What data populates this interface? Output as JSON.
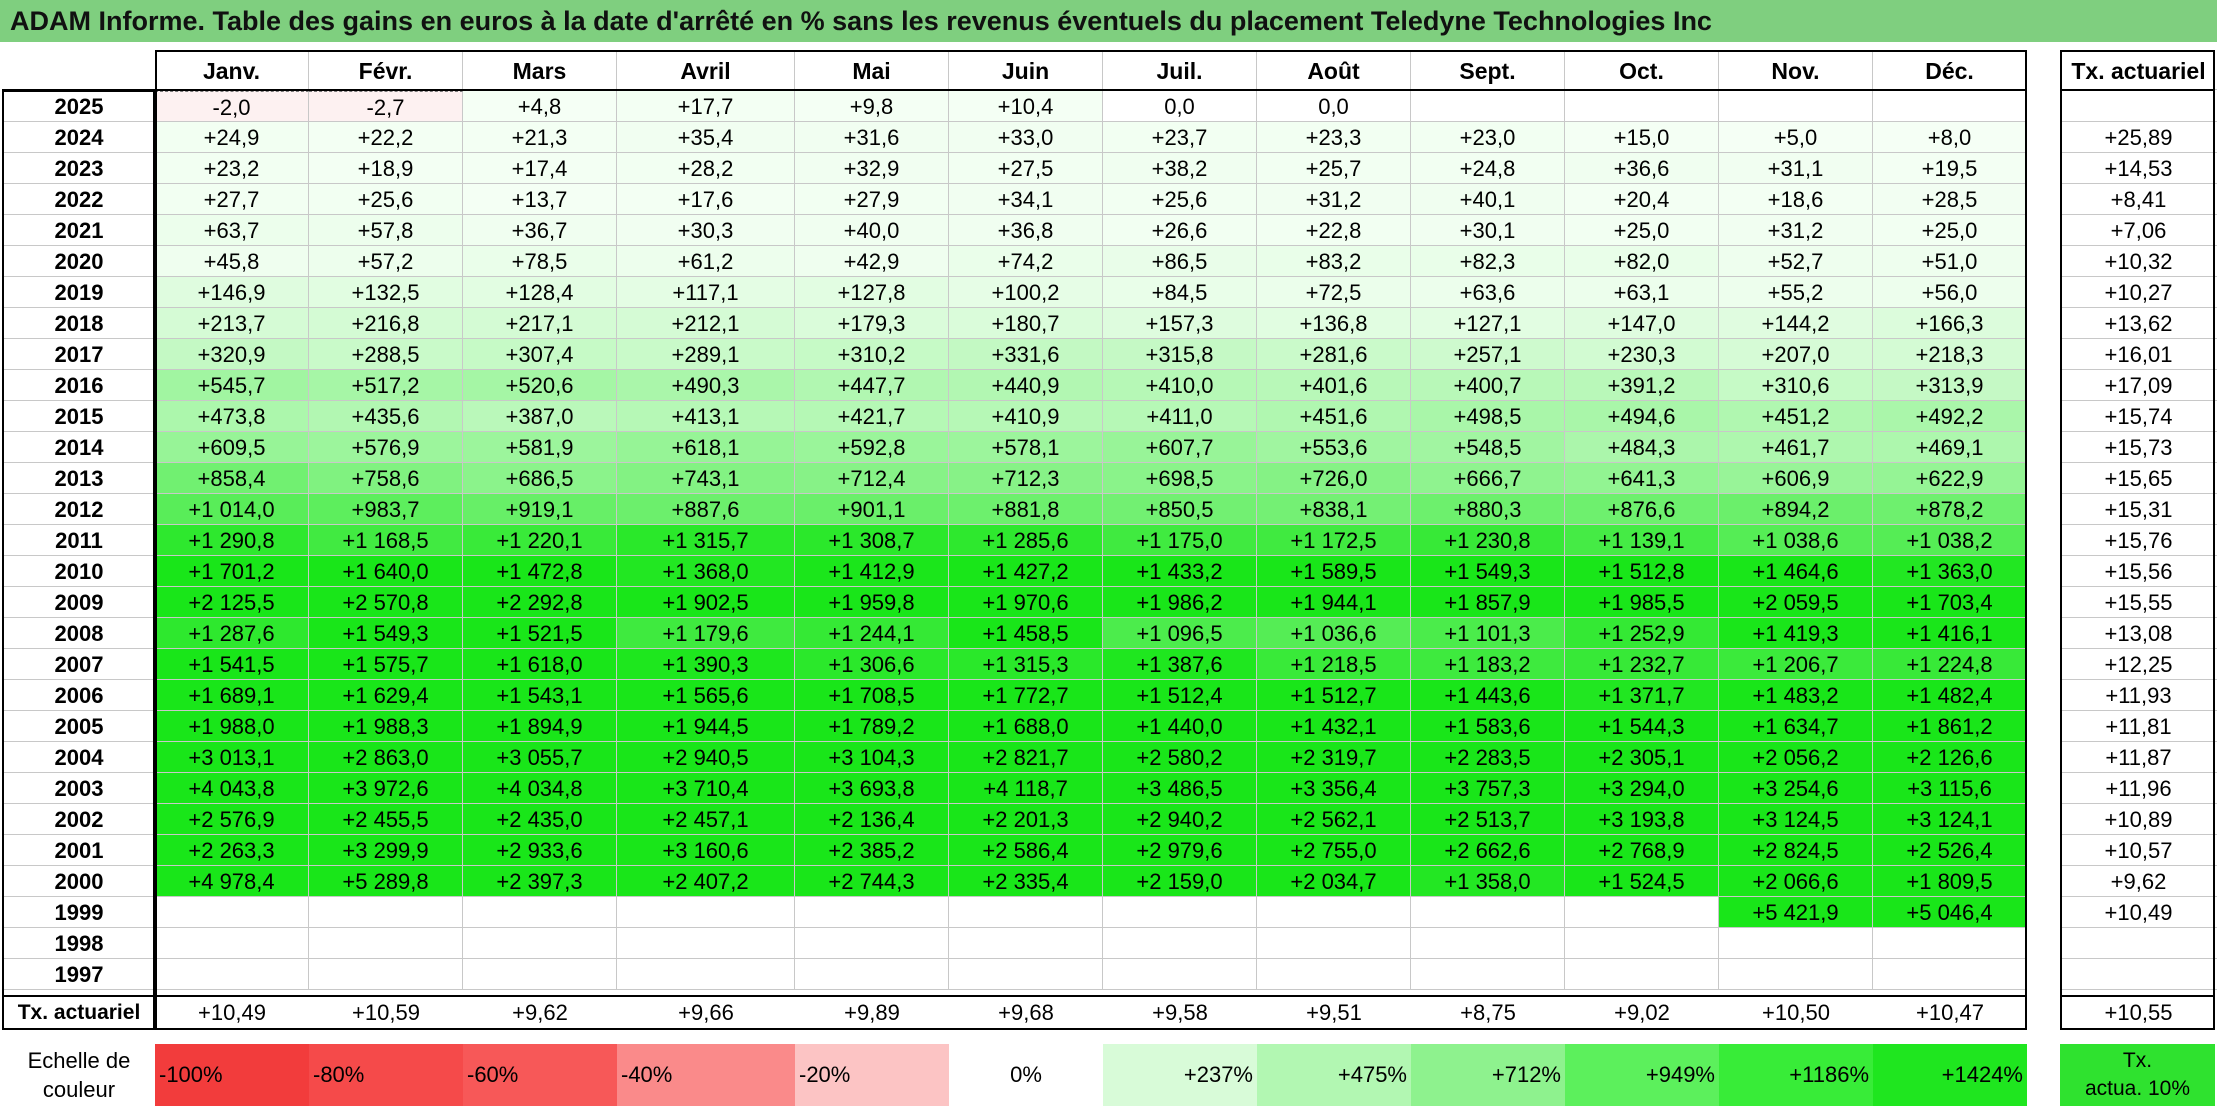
{
  "title": "ADAM Informe. Table des gains en euros à la date d'arrêté en % sans les revenus éventuels du placement Teledyne Technologies Inc",
  "months": [
    "Janv.",
    "Févr.",
    "Mars",
    "Avril",
    "Mai",
    "Juin",
    "Juil.",
    "Août",
    "Sept.",
    "Oct.",
    "Nov.",
    "Déc."
  ],
  "actuarial_header": "Tx. actuariel",
  "rows": [
    {
      "year": "2025",
      "values": [
        "-2,0",
        "-2,7",
        "+4,8",
        "+17,7",
        "+9,8",
        "+10,4",
        "0,0",
        "0,0",
        "",
        "",
        "",
        ""
      ],
      "actuarial": ""
    },
    {
      "year": "2024",
      "values": [
        "+24,9",
        "+22,2",
        "+21,3",
        "+35,4",
        "+31,6",
        "+33,0",
        "+23,7",
        "+23,3",
        "+23,0",
        "+15,0",
        "+5,0",
        "+8,0"
      ],
      "actuarial": "+25,89"
    },
    {
      "year": "2023",
      "values": [
        "+23,2",
        "+18,9",
        "+17,4",
        "+28,2",
        "+32,9",
        "+27,5",
        "+38,2",
        "+25,7",
        "+24,8",
        "+36,6",
        "+31,1",
        "+19,5"
      ],
      "actuarial": "+14,53"
    },
    {
      "year": "2022",
      "values": [
        "+27,7",
        "+25,6",
        "+13,7",
        "+17,6",
        "+27,9",
        "+34,1",
        "+25,6",
        "+31,2",
        "+40,1",
        "+20,4",
        "+18,6",
        "+28,5"
      ],
      "actuarial": "+8,41"
    },
    {
      "year": "2021",
      "values": [
        "+63,7",
        "+57,8",
        "+36,7",
        "+30,3",
        "+40,0",
        "+36,8",
        "+26,6",
        "+22,8",
        "+30,1",
        "+25,0",
        "+31,2",
        "+25,0"
      ],
      "actuarial": "+7,06"
    },
    {
      "year": "2020",
      "values": [
        "+45,8",
        "+57,2",
        "+78,5",
        "+61,2",
        "+42,9",
        "+74,2",
        "+86,5",
        "+83,2",
        "+82,3",
        "+82,0",
        "+52,7",
        "+51,0"
      ],
      "actuarial": "+10,32"
    },
    {
      "year": "2019",
      "values": [
        "+146,9",
        "+132,5",
        "+128,4",
        "+117,1",
        "+127,8",
        "+100,2",
        "+84,5",
        "+72,5",
        "+63,6",
        "+63,1",
        "+55,2",
        "+56,0"
      ],
      "actuarial": "+10,27"
    },
    {
      "year": "2018",
      "values": [
        "+213,7",
        "+216,8",
        "+217,1",
        "+212,1",
        "+179,3",
        "+180,7",
        "+157,3",
        "+136,8",
        "+127,1",
        "+147,0",
        "+144,2",
        "+166,3"
      ],
      "actuarial": "+13,62"
    },
    {
      "year": "2017",
      "values": [
        "+320,9",
        "+288,5",
        "+307,4",
        "+289,1",
        "+310,2",
        "+331,6",
        "+315,8",
        "+281,6",
        "+257,1",
        "+230,3",
        "+207,0",
        "+218,3"
      ],
      "actuarial": "+16,01"
    },
    {
      "year": "2016",
      "values": [
        "+545,7",
        "+517,2",
        "+520,6",
        "+490,3",
        "+447,7",
        "+440,9",
        "+410,0",
        "+401,6",
        "+400,7",
        "+391,2",
        "+310,6",
        "+313,9"
      ],
      "actuarial": "+17,09"
    },
    {
      "year": "2015",
      "values": [
        "+473,8",
        "+435,6",
        "+387,0",
        "+413,1",
        "+421,7",
        "+410,9",
        "+411,0",
        "+451,6",
        "+498,5",
        "+494,6",
        "+451,2",
        "+492,2"
      ],
      "actuarial": "+15,74"
    },
    {
      "year": "2014",
      "values": [
        "+609,5",
        "+576,9",
        "+581,9",
        "+618,1",
        "+592,8",
        "+578,1",
        "+607,7",
        "+553,6",
        "+548,5",
        "+484,3",
        "+461,7",
        "+469,1"
      ],
      "actuarial": "+15,73"
    },
    {
      "year": "2013",
      "values": [
        "+858,4",
        "+758,6",
        "+686,5",
        "+743,1",
        "+712,4",
        "+712,3",
        "+698,5",
        "+726,0",
        "+666,7",
        "+641,3",
        "+606,9",
        "+622,9"
      ],
      "actuarial": "+15,65"
    },
    {
      "year": "2012",
      "values": [
        "+1 014,0",
        "+983,7",
        "+919,1",
        "+887,6",
        "+901,1",
        "+881,8",
        "+850,5",
        "+838,1",
        "+880,3",
        "+876,6",
        "+894,2",
        "+878,2"
      ],
      "actuarial": "+15,31"
    },
    {
      "year": "2011",
      "values": [
        "+1 290,8",
        "+1 168,5",
        "+1 220,1",
        "+1 315,7",
        "+1 308,7",
        "+1 285,6",
        "+1 175,0",
        "+1 172,5",
        "+1 230,8",
        "+1 139,1",
        "+1 038,6",
        "+1 038,2"
      ],
      "actuarial": "+15,76"
    },
    {
      "year": "2010",
      "values": [
        "+1 701,2",
        "+1 640,0",
        "+1 472,8",
        "+1 368,0",
        "+1 412,9",
        "+1 427,2",
        "+1 433,2",
        "+1 589,5",
        "+1 549,3",
        "+1 512,8",
        "+1 464,6",
        "+1 363,0"
      ],
      "actuarial": "+15,56"
    },
    {
      "year": "2009",
      "values": [
        "+2 125,5",
        "+2 570,8",
        "+2 292,8",
        "+1 902,5",
        "+1 959,8",
        "+1 970,6",
        "+1 986,2",
        "+1 944,1",
        "+1 857,9",
        "+1 985,5",
        "+2 059,5",
        "+1 703,4"
      ],
      "actuarial": "+15,55"
    },
    {
      "year": "2008",
      "values": [
        "+1 287,6",
        "+1 549,3",
        "+1 521,5",
        "+1 179,6",
        "+1 244,1",
        "+1 458,5",
        "+1 096,5",
        "+1 036,6",
        "+1 101,3",
        "+1 252,9",
        "+1 419,3",
        "+1 416,1"
      ],
      "actuarial": "+13,08"
    },
    {
      "year": "2007",
      "values": [
        "+1 541,5",
        "+1 575,7",
        "+1 618,0",
        "+1 390,3",
        "+1 306,6",
        "+1 315,3",
        "+1 387,6",
        "+1 218,5",
        "+1 183,2",
        "+1 232,7",
        "+1 206,7",
        "+1 224,8"
      ],
      "actuarial": "+12,25"
    },
    {
      "year": "2006",
      "values": [
        "+1 689,1",
        "+1 629,4",
        "+1 543,1",
        "+1 565,6",
        "+1 708,5",
        "+1 772,7",
        "+1 512,4",
        "+1 512,7",
        "+1 443,6",
        "+1 371,7",
        "+1 483,2",
        "+1 482,4"
      ],
      "actuarial": "+11,93"
    },
    {
      "year": "2005",
      "values": [
        "+1 988,0",
        "+1 988,3",
        "+1 894,9",
        "+1 944,5",
        "+1 789,2",
        "+1 688,0",
        "+1 440,0",
        "+1 432,1",
        "+1 583,6",
        "+1 544,3",
        "+1 634,7",
        "+1 861,2"
      ],
      "actuarial": "+11,81"
    },
    {
      "year": "2004",
      "values": [
        "+3 013,1",
        "+2 863,0",
        "+3 055,7",
        "+2 940,5",
        "+3 104,3",
        "+2 821,7",
        "+2 580,2",
        "+2 319,7",
        "+2 283,5",
        "+2 305,1",
        "+2 056,2",
        "+2 126,6"
      ],
      "actuarial": "+11,87"
    },
    {
      "year": "2003",
      "values": [
        "+4 043,8",
        "+3 972,6",
        "+4 034,8",
        "+3 710,4",
        "+3 693,8",
        "+4 118,7",
        "+3 486,5",
        "+3 356,4",
        "+3 757,3",
        "+3 294,0",
        "+3 254,6",
        "+3 115,6"
      ],
      "actuarial": "+11,96"
    },
    {
      "year": "2002",
      "values": [
        "+2 576,9",
        "+2 455,5",
        "+2 435,0",
        "+2 457,1",
        "+2 136,4",
        "+2 201,3",
        "+2 940,2",
        "+2 562,1",
        "+2 513,7",
        "+3 193,8",
        "+3 124,5",
        "+3 124,1"
      ],
      "actuarial": "+10,89"
    },
    {
      "year": "2001",
      "values": [
        "+2 263,3",
        "+3 299,9",
        "+2 933,6",
        "+3 160,6",
        "+2 385,2",
        "+2 586,4",
        "+2 979,6",
        "+2 755,0",
        "+2 662,6",
        "+2 768,9",
        "+2 824,5",
        "+2 526,4"
      ],
      "actuarial": "+10,57"
    },
    {
      "year": "2000",
      "values": [
        "+4 978,4",
        "+5 289,8",
        "+2 397,3",
        "+2 407,2",
        "+2 744,3",
        "+2 335,4",
        "+2 159,0",
        "+2 034,7",
        "+1 358,0",
        "+1 524,5",
        "+2 066,6",
        "+1 809,5"
      ],
      "actuarial": "+9,62"
    },
    {
      "year": "1999",
      "values": [
        "",
        "",
        "",
        "",
        "",
        "",
        "",
        "",
        "",
        "",
        "+5 421,9",
        "+5 046,4"
      ],
      "actuarial": "+10,49"
    },
    {
      "year": "1998",
      "values": [
        "",
        "",
        "",
        "",
        "",
        "",
        "",
        "",
        "",
        "",
        "",
        ""
      ],
      "actuarial": ""
    },
    {
      "year": "1997",
      "values": [
        "",
        "",
        "",
        "",
        "",
        "",
        "",
        "",
        "",
        "",
        "",
        ""
      ],
      "actuarial": ""
    }
  ],
  "footer": {
    "label": "Tx. actuariel",
    "values": [
      "+10,49",
      "+10,59",
      "+9,62",
      "+9,66",
      "+9,89",
      "+9,68",
      "+9,58",
      "+9,51",
      "+8,75",
      "+9,02",
      "+10,50",
      "+10,47"
    ],
    "overall": "+10,55"
  },
  "legend": {
    "label_line1": "Echelle de",
    "label_line2": "couleur",
    "items": [
      {
        "text": "-100%",
        "color": "#f23c3c"
      },
      {
        "text": "-80%",
        "color": "#f54a4a"
      },
      {
        "text": "-60%",
        "color": "#f75858"
      },
      {
        "text": "-40%",
        "color": "#fa8a8a"
      },
      {
        "text": "-20%",
        "color": "#fcc4c4"
      },
      {
        "text": "0%",
        "color": "#ffffff"
      },
      {
        "text": "+237%",
        "color": "#d8fbd8"
      },
      {
        "text": "+475%",
        "color": "#b2f7b2"
      },
      {
        "text": "+712%",
        "color": "#8ef28e"
      },
      {
        "text": "+949%",
        "color": "#5cf05c"
      },
      {
        "text": "+1186%",
        "color": "#38ec38"
      },
      {
        "text": "+1424%",
        "color": "#1fe61f"
      }
    ],
    "actua_line1": "Tx.",
    "actua_line2": "actua. 10%",
    "actua_color": "#2fe22f"
  }
}
